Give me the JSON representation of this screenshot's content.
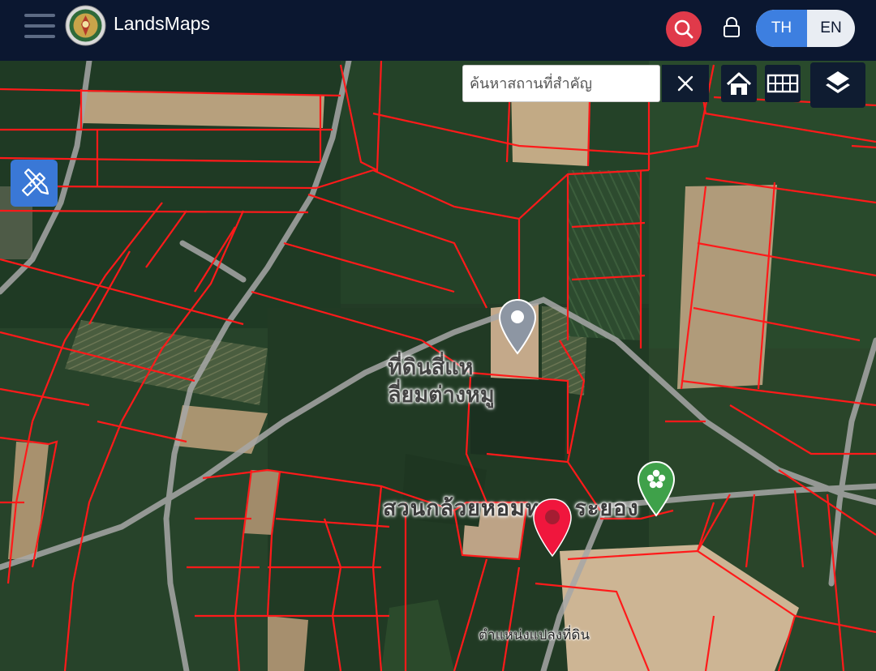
{
  "header": {
    "app_title": "LandsMaps",
    "lang_th": "TH",
    "lang_en": "EN",
    "active_language": "TH",
    "background_color": "#0b1730",
    "search_button_color": "#e03a4a",
    "toggle_active_color": "#3d7fe0"
  },
  "map": {
    "search_placeholder": "ค้นหาสถานที่สำคัญ",
    "clear_icon": "close-icon",
    "tools": [
      "home-icon",
      "grid-icon",
      "layers-icon"
    ],
    "draw_tool_icon": "ruler-pencil-icon",
    "parcel_line_color": "#ff1a1a",
    "labels": {
      "poi_line1": "ที่ดินสี่แห",
      "poi_line2": "ลี่ยมต่างหมู",
      "garden": "สวนกล้วยหอมทอง ระยอง",
      "pin": "ตำแหน่งแปลงที่ดิน"
    },
    "markers": [
      "gray-pin-icon",
      "green-flower-pin-icon",
      "red-location-pin-icon"
    ]
  }
}
